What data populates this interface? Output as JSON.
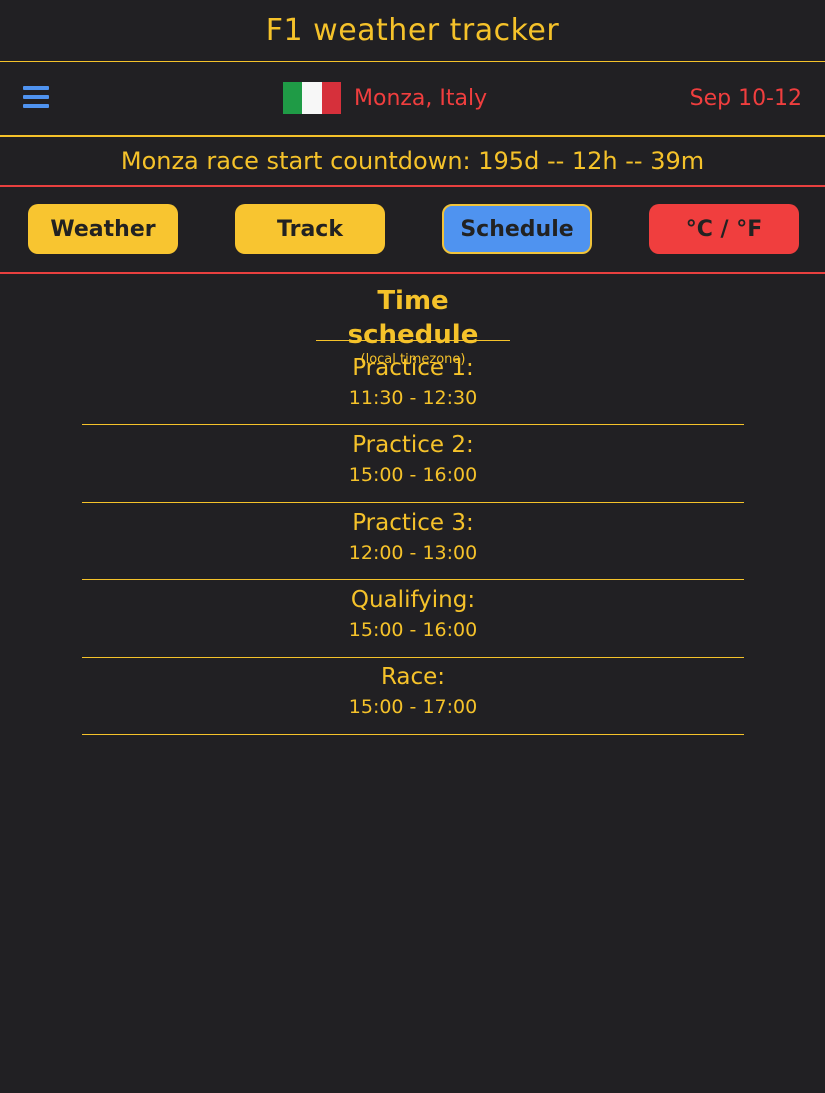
{
  "app": {
    "title": "F1 weather tracker"
  },
  "header": {
    "location": "Monza, Italy",
    "dates": "Sep 10-12",
    "flag": {
      "country": "Italy",
      "colors": [
        "#1f9b46",
        "#f7f7f7",
        "#d6303b"
      ]
    },
    "menu_icon": "hamburger-menu-icon"
  },
  "countdown": {
    "text": "Monza race start countdown: 195d -- 12h -- 39m"
  },
  "tabs": {
    "weather": "Weather",
    "track": "Track",
    "schedule": "Schedule",
    "units": "°C / °F",
    "active": "Schedule"
  },
  "schedule": {
    "title": "Time schedule",
    "subtitle": "(local timezone)",
    "sessions": [
      {
        "name": "Practice 1:",
        "time": "11:30 - 12:30"
      },
      {
        "name": "Practice 2:",
        "time": "15:00 - 16:00"
      },
      {
        "name": "Practice 3:",
        "time": "12:00 - 13:00"
      },
      {
        "name": "Qualifying:",
        "time": "15:00 - 16:00"
      },
      {
        "name": "Race:",
        "time": "15:00 - 17:00"
      }
    ]
  },
  "colors": {
    "background": "#212023",
    "accent_yellow": "#f5c22a",
    "accent_red": "#f03e3e",
    "accent_blue": "#4f93f0"
  }
}
